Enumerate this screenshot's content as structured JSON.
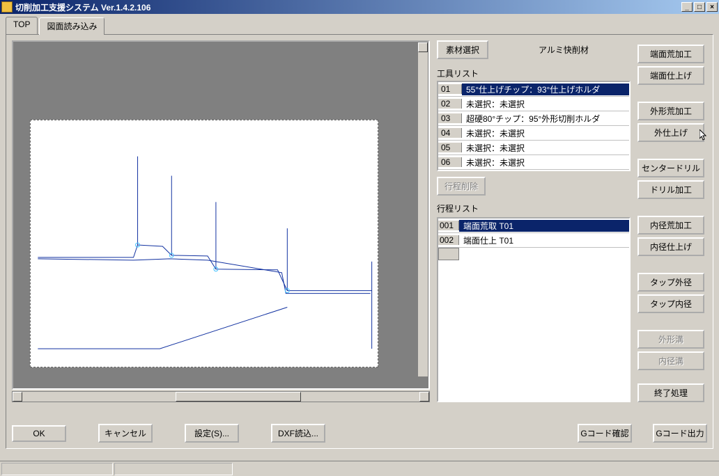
{
  "window": {
    "title": "切削加工支援システム Ver.1.4.2.106",
    "buttons": {
      "min": "_",
      "max": "□",
      "close": "×"
    }
  },
  "tabs": {
    "top": "TOP",
    "drawing": "図面読み込み"
  },
  "material": {
    "button": "素材選択",
    "value": "アルミ快削材"
  },
  "tool_list": {
    "label": "工具リスト",
    "rows": [
      {
        "no": "01",
        "desc": "55°仕上げチップ：93°仕上げホルダ",
        "selected": true
      },
      {
        "no": "02",
        "desc": "未選択：未選択",
        "selected": false
      },
      {
        "no": "03",
        "desc": "超硬80°チップ：95°外形切削ホルダ",
        "selected": false
      },
      {
        "no": "04",
        "desc": "未選択：未選択",
        "selected": false
      },
      {
        "no": "05",
        "desc": "未選択：未選択",
        "selected": false
      },
      {
        "no": "06",
        "desc": "未選択：未選択",
        "selected": false
      }
    ]
  },
  "process": {
    "delete_button": "行程削除",
    "label": "行程リスト",
    "rows": [
      {
        "no": "001",
        "desc": "端面荒取 T01",
        "selected": true
      },
      {
        "no": "002",
        "desc": "端面仕上 T01",
        "selected": false
      }
    ]
  },
  "op_buttons": {
    "face_rough": "端面荒加工",
    "face_finish": "端面仕上げ",
    "outer_rough": "外形荒加工",
    "outer_finish": "外仕上げ",
    "center_drill": "センタードリル",
    "drill": "ドリル加工",
    "inner_rough": "内径荒加工",
    "inner_finish": "内径仕上げ",
    "tap_outer": "タップ外径",
    "tap_inner": "タップ内径",
    "outer_groove": "外形溝",
    "inner_groove": "内径溝",
    "end_process": "終了処理"
  },
  "bottom": {
    "ok": "OK",
    "cancel": "キャンセル",
    "settings": "設定(S)...",
    "dxf_load": "DXF読込...",
    "gcode_check": "Gコード確認",
    "gcode_output": "Gコード出力"
  }
}
